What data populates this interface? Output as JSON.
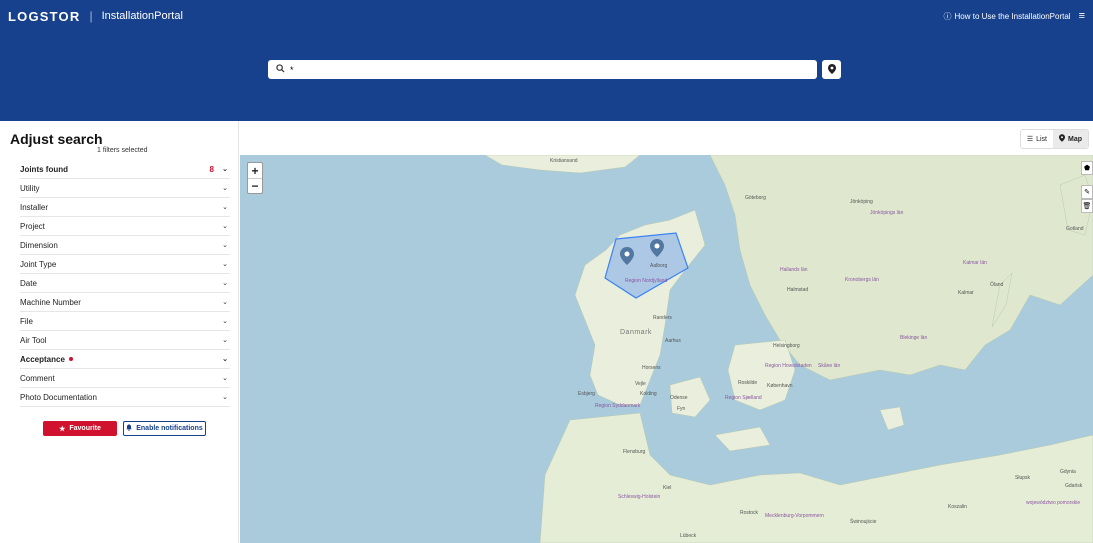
{
  "header": {
    "brand": "LOGSTOR",
    "separator": "|",
    "portal_name": "InstallationPortal",
    "help_link": "How to Use the InstallationPortal",
    "search_value": "*"
  },
  "sidebar": {
    "title": "Adjust search",
    "filters_selected": "1 filters selected",
    "filters": [
      {
        "label": "Joints found",
        "count": "8"
      },
      {
        "label": "Utility"
      },
      {
        "label": "Installer"
      },
      {
        "label": "Project"
      },
      {
        "label": "Dimension"
      },
      {
        "label": "Joint Type"
      },
      {
        "label": "Date"
      },
      {
        "label": "Machine Number"
      },
      {
        "label": "File"
      },
      {
        "label": "Air Tool"
      },
      {
        "label": "Acceptance"
      },
      {
        "label": "Comment"
      },
      {
        "label": "Photo Documentation"
      }
    ],
    "favourite_label": "Favourite",
    "notifications_label": "Enable notifications"
  },
  "view_toggle": {
    "list_label": "List",
    "map_label": "Map",
    "active": "Map"
  },
  "map": {
    "zoom_in": "+",
    "zoom_out": "−",
    "labels": {
      "kristiansand": "Kristiansand",
      "goteborg": "Göteborg",
      "jonkoping": "Jönköping",
      "jonkopings_lan": "Jönköpings län",
      "gotland": "Gotland",
      "halmstad": "Halmstad",
      "kronobergs": "Kronobergs län",
      "kalmar_lan": "Kalmar län",
      "kalmar": "Kalmar",
      "oland": "Öland",
      "hallands": "Hallands län",
      "aalborg": "Aalborg",
      "region_nord": "Region Nordjylland",
      "randers": "Randers",
      "danmark": "Danmark",
      "aarhus": "Aarhus",
      "horsens": "Horsens",
      "vejle": "Vejle",
      "kolding": "Kolding",
      "esbjerg": "Esbjerg",
      "odense": "Odense",
      "fyn": "Fyn",
      "region_syd": "Region Syddanmark",
      "roskilde": "Roskilde",
      "kobenhavn": "København",
      "region_sjaelland": "Region Sjælland",
      "helsingborg": "Helsingborg",
      "skane": "Skåne län",
      "blekinge": "Blekinge län",
      "flensburg": "Flensburg",
      "kiel": "Kiel",
      "schleswig": "Schleswig-Holstein",
      "rostock": "Rostock",
      "mecklenburg": "Mecklenburg-Vorpommern",
      "lubeck": "Lübeck",
      "swinoujscie": "Świnoujście",
      "koszalin": "Koszalin",
      "slupsk": "Słupsk",
      "gdynia": "Gdynia",
      "gdansk": "Gdańsk",
      "pomorskie": "województwo pomorskie",
      "region_hovedstaden": "Region Hovedstaden"
    }
  },
  "colors": {
    "header_bg": "#17418d",
    "accent_red": "#d1122e",
    "water": "#a9cbdc",
    "land": "#e9efdc",
    "polygon": "#3b82f6"
  }
}
